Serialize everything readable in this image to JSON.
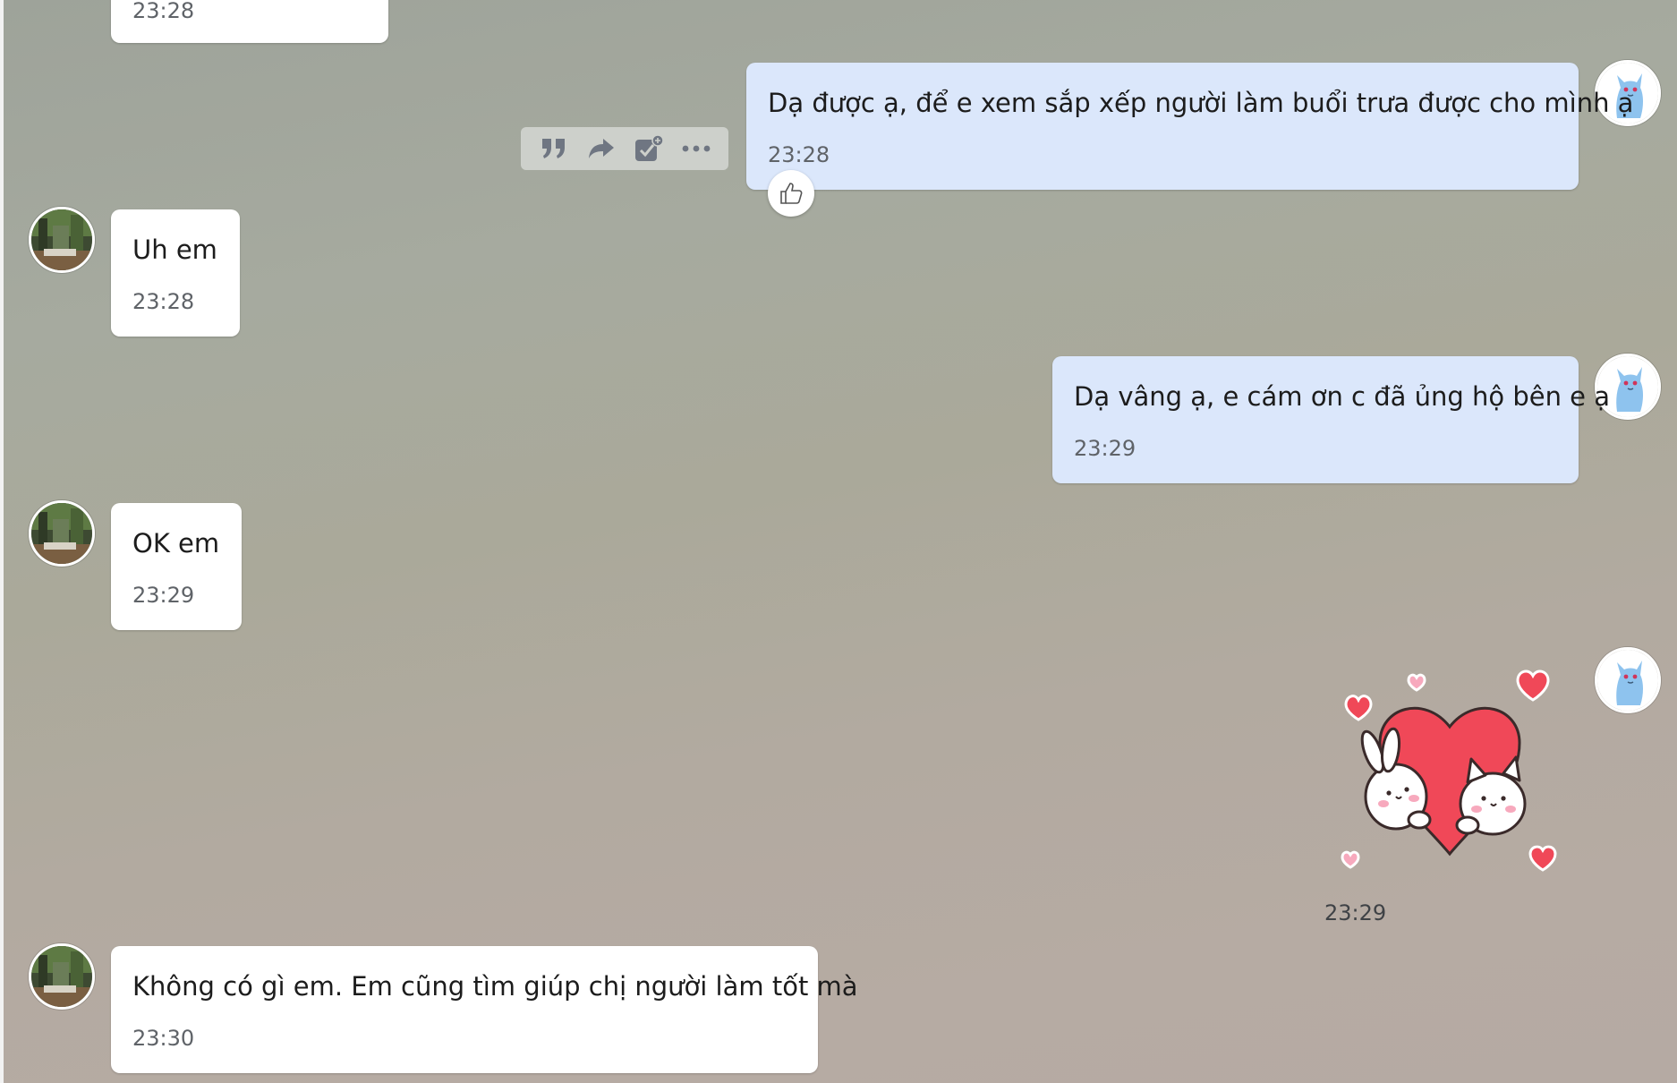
{
  "messages": [
    {
      "text": "",
      "time": "23:28"
    },
    {
      "text": "Dạ được ạ, để e xem sắp xếp người làm buổi trưa được cho mình ạ",
      "time": "23:28"
    },
    {
      "text": "Uh em",
      "time": "23:28"
    },
    {
      "text": "Dạ vâng ạ, e cám ơn c đã ủng hộ bên e ạ",
      "time": "23:29"
    },
    {
      "text": "OK em",
      "time": "23:29"
    },
    {
      "sticker": "hearts-bunny-cat-sticker",
      "time": "23:29"
    },
    {
      "text": "Không có gì em. Em cũng tìm giúp chị người làm tốt mà",
      "time": "23:30"
    }
  ],
  "message_actions": [
    "quote-icon",
    "forward-icon",
    "task-add-icon",
    "more-icon"
  ],
  "reaction": "thumbs-up-icon",
  "colors": {
    "incoming_bubble": "#ffffff",
    "outgoing_bubble": "#dbe7fb",
    "heart_red": "#f04858",
    "heart_pink": "#f7a9bd",
    "cat_avatar_blue": "#8ec3ee"
  }
}
